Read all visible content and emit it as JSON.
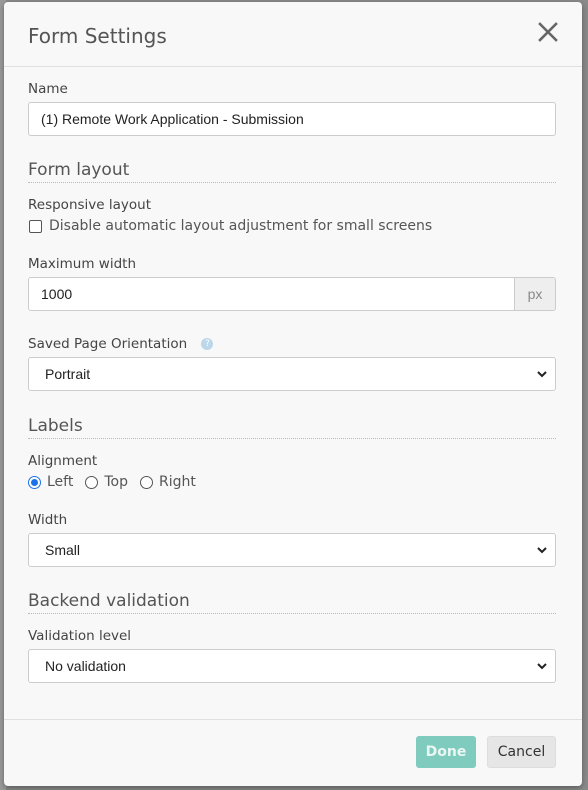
{
  "modal": {
    "title": "Form Settings",
    "close_icon": "close-icon"
  },
  "name_field": {
    "label": "Name",
    "value": "(1) Remote Work Application - Submission"
  },
  "form_layout": {
    "section_title": "Form layout",
    "responsive_label": "Responsive layout",
    "responsive_checkbox_label": "Disable automatic layout adjustment for small screens",
    "responsive_checked": false,
    "max_width_label": "Maximum width",
    "max_width_value": "1000",
    "max_width_unit": "px",
    "orientation_label": "Saved Page Orientation",
    "orientation_help_icon": "question-circle-icon",
    "orientation_value": "Portrait"
  },
  "labels": {
    "section_title": "Labels",
    "alignment_label": "Alignment",
    "alignment_options": [
      "Left",
      "Top",
      "Right"
    ],
    "alignment_selected": "Left",
    "width_label": "Width",
    "width_value": "Small"
  },
  "backend_validation": {
    "section_title": "Backend validation",
    "level_label": "Validation level",
    "level_value": "No validation"
  },
  "footer": {
    "done_label": "Done",
    "cancel_label": "Cancel"
  },
  "colors": {
    "done_button": "#7fcbbd",
    "radio_accent": "#1a73e8"
  }
}
